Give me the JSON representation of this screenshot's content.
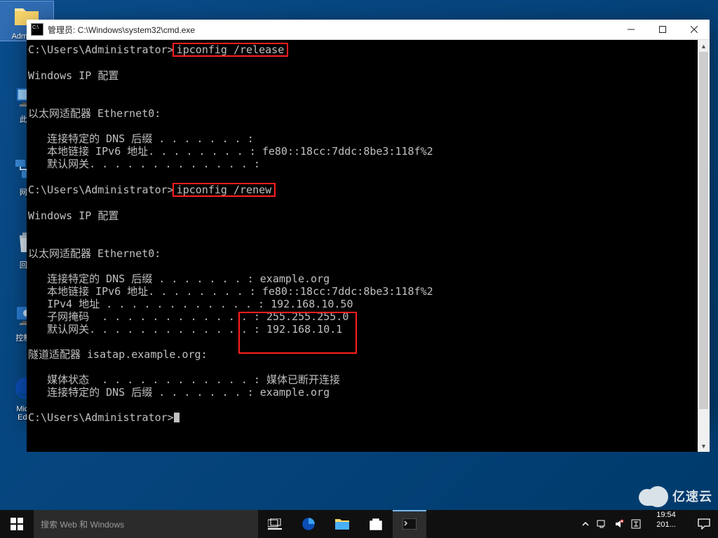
{
  "desktop_icons": {
    "0": {
      "label": "Admini..."
    },
    "1": {
      "label": "此..."
    },
    "2": {
      "label": "网..."
    },
    "3": {
      "label": "回..."
    },
    "4": {
      "label": "控制..."
    },
    "5": {
      "label": "Micr...",
      "sub": "Edge"
    }
  },
  "window": {
    "title": "管理员: C:\\Windows\\system32\\cmd.exe"
  },
  "terminal": {
    "prompt": "C:\\Users\\Administrator>",
    "cmd1": "ipconfig /release",
    "block1_header": "Windows IP 配置",
    "block1_adapter": "以太网适配器 Ethernet0:",
    "block1_l1": "   连接特定的 DNS 后缀 . . . . . . . :",
    "block1_l2": "   本地链接 IPv6 地址. . . . . . . . : fe80::18cc:7ddc:8be3:118f%2",
    "block1_l3": "   默认网关. . . . . . . . . . . . . :",
    "cmd2": "ipconfig /renew",
    "block2_header": "Windows IP 配置",
    "block2_adapter": "以太网适配器 Ethernet0:",
    "block2_l1": "   连接特定的 DNS 后缀 . . . . . . . : example.org",
    "block2_l2": "   本地链接 IPv6 地址. . . . . . . . : fe80::18cc:7ddc:8be3:118f%2",
    "block2_l3a": "   IPv4 地址 . . . . . . . . . . . . : ",
    "block2_l3b": "192.168.10.50",
    "block2_l4a": "   子网掩码  . . . . . . . . . . . . : ",
    "block2_l4b": "255.255.255.0",
    "block2_l5a": "   默认网关. . . . . . . . . . . . . : ",
    "block2_l5b": "192.168.10.1",
    "tunnel_adapter": "隧道适配器 isatap.example.org:",
    "tunnel_l1": "   媒体状态  . . . . . . . . . . . . : 媒体已断开连接",
    "tunnel_l2": "   连接特定的 DNS 后缀 . . . . . . . : example.org"
  },
  "taskbar": {
    "search_placeholder": "搜索 Web 和 Windows",
    "time": "19:54",
    "date": "201..."
  },
  "watermark": {
    "text": "亿速云"
  }
}
